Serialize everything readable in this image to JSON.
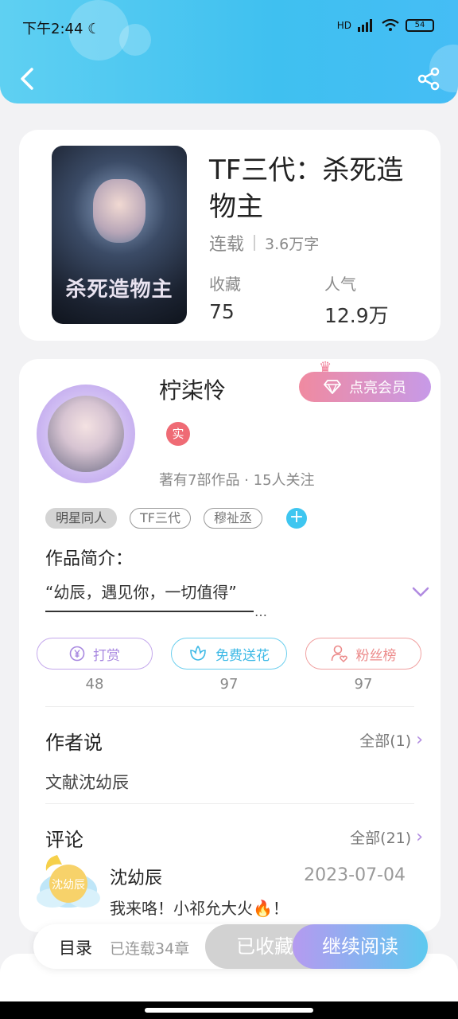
{
  "status_bar": {
    "time": "下午2:44",
    "network": "HD",
    "battery": "54"
  },
  "colors": {
    "accent": "#3fc0f0",
    "purple": "#b08ae0",
    "pink": "#ef6b75",
    "reward": "#b08ae0",
    "flower": "#3ec6f0",
    "fans": "#ef8f8f"
  },
  "header": {
    "back_icon": "chevron-left-icon",
    "share_icon": "share-icon"
  },
  "book": {
    "cover_title": "杀死造物主",
    "title": "TF三代：杀死造物主",
    "status": "连载",
    "word_count": "3.6万字",
    "collect_label": "收藏",
    "collect_value": "75",
    "popularity_label": "人气",
    "popularity_value": "12.9万"
  },
  "author": {
    "name": "柠柒怜",
    "vip_button": "点亮会员",
    "real_badge": "实",
    "meta": "著有7部作品 · 15人关注",
    "tags": [
      "明星同人",
      "TF三代",
      "穆祉丞"
    ]
  },
  "intro": {
    "title": "作品简介：",
    "text": "“幼辰，遇见你，一切值得”",
    "ellipsis": "…"
  },
  "actions": [
    {
      "label": "打赏",
      "count": "48",
      "icon": "yen-coin-icon"
    },
    {
      "label": "免费送花",
      "count": "97",
      "icon": "flower-icon"
    },
    {
      "label": "粉丝榜",
      "count": "97",
      "icon": "user-heart-icon"
    }
  ],
  "author_say": {
    "title": "作者说",
    "link": "全部(1)",
    "text": "文献沈幼辰"
  },
  "comments": {
    "title": "评论",
    "link": "全部(21)",
    "items": [
      {
        "user": "沈幼辰",
        "date": "2023-07-04",
        "text": "我来咯！小祁允大火🔥！",
        "avatar_text": "沈幼辰"
      }
    ]
  },
  "bottom_bar": {
    "toc": "目录",
    "serial_count": "已连载34章",
    "collected": "已收藏",
    "continue": "继续阅读"
  }
}
